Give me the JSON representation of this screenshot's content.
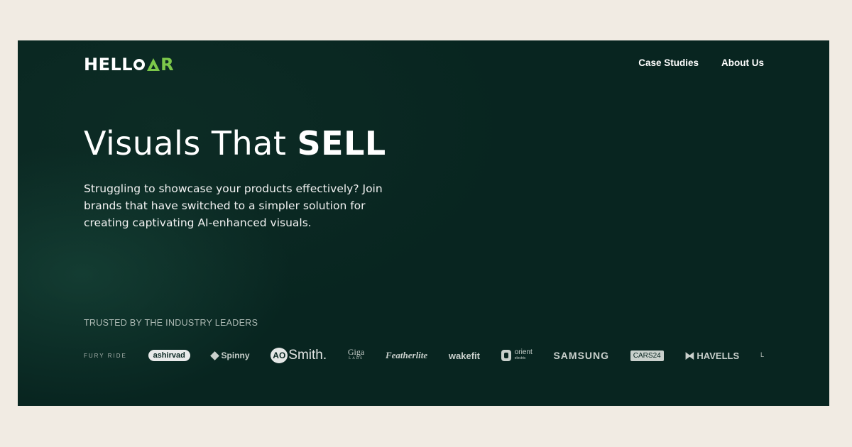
{
  "header": {
    "logo": {
      "text_main": "HELL",
      "text_accent": "R",
      "accent_color": "#7cc74a"
    },
    "nav": [
      {
        "label": "Case Studies"
      },
      {
        "label": "About Us"
      }
    ]
  },
  "hero": {
    "headline_light": "Visuals That ",
    "headline_bold": "SELL",
    "subtext": "Struggling to showcase your products effectively? Join brands that have switched to a simpler solution for creating captivating AI-enhanced visuals."
  },
  "trusted": {
    "heading": "TRUSTED BY THE INDUSTRY LEADERS",
    "brands": [
      "FURY RIDE",
      "ashirvad",
      "Spinny",
      "Smith.",
      "Giga",
      "Featherlite",
      "wakefit",
      "orient",
      "SAMSUNG",
      "CARS",
      "HAVELLS"
    ],
    "brand_sub": {
      "ao": "AO",
      "giga": "LABS",
      "orient": "electric",
      "cars_suffix": "24"
    }
  },
  "colors": {
    "page_bg": "#f1ebe3",
    "hero_bg": "#082520",
    "accent": "#7cc74a"
  }
}
